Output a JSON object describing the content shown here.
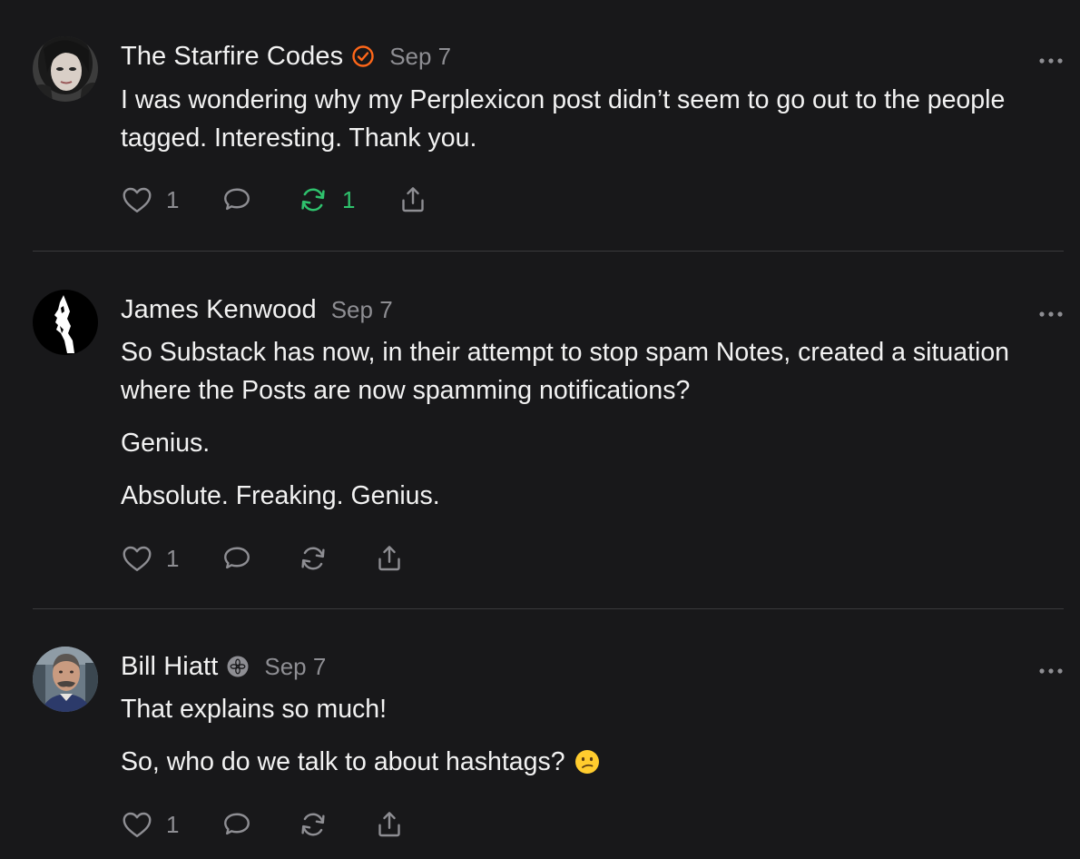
{
  "notes": [
    {
      "author": "The Starfire Codes",
      "date": "Sep 7",
      "paragraphs": [
        "I was wondering why my Perplexicon post didn’t seem to go out to the people tagged. Interesting. Thank you."
      ],
      "like_count": "1",
      "restack_count": "1",
      "badge": "orange-check-badge-icon"
    },
    {
      "author": "James Kenwood",
      "date": "Sep 7",
      "paragraphs": [
        "So Substack has now, in their attempt to stop spam Notes, created a situation where the Posts are now spamming notifications?",
        "Genius.",
        "Absolute. Freaking. Genius."
      ],
      "like_count": "1"
    },
    {
      "author": "Bill Hiatt",
      "date": "Sep 7",
      "paragraphs": [
        "That explains so much!",
        "So, who do we talk to about hashtags?"
      ],
      "like_count": "1",
      "badge": "gray-flower-badge-icon",
      "emoji": "confused-face-emoji"
    }
  ],
  "colors": {
    "background": "#18181a",
    "text": "#f2f2f2",
    "muted": "#8e8e93",
    "restack_active": "#2fc26d",
    "badge_orange": "#ff6719",
    "divider": "#3a3a3c"
  }
}
